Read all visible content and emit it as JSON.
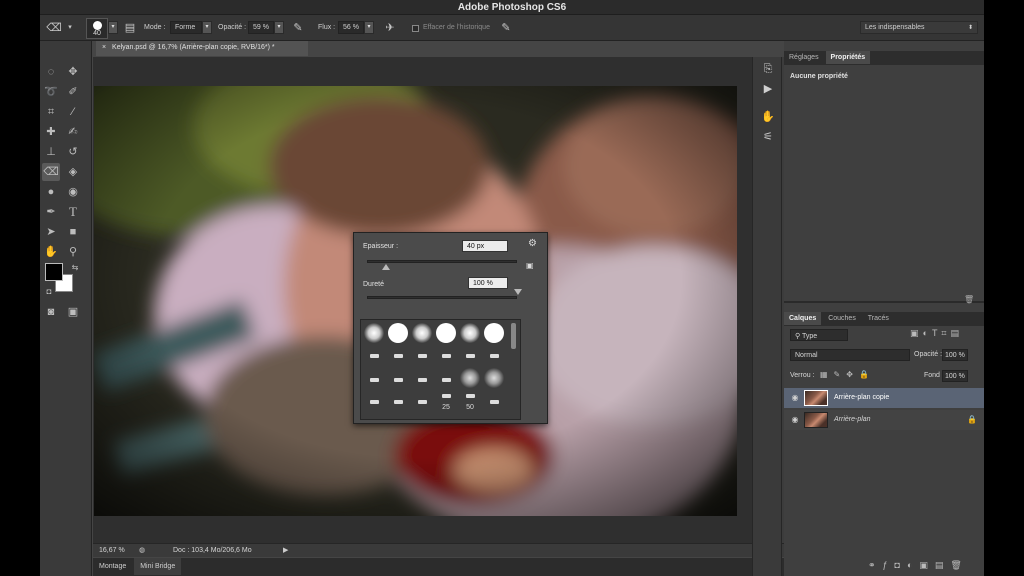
{
  "titlebar": {
    "title": "Adobe Photoshop CS6"
  },
  "options": {
    "brush_size": "40",
    "mode_label": "Mode :",
    "mode_value": "Forme",
    "opacity_label": "Opacité :",
    "opacity_value": "59 %",
    "flow_label": "Flux :",
    "flow_value": "56 %",
    "history_label": "Effacer de l'historique",
    "workspace": "Les indispensables"
  },
  "document": {
    "tab_title": "Kelyan.psd @ 16,7% (Arrière-plan copie, RVB/16*) *",
    "zoom": "16,67 %",
    "doc_info": "Doc : 103,4 Mo/206,6 Mo"
  },
  "bottom_tabs": [
    "Montage",
    "Mini Bridge"
  ],
  "brush_popup": {
    "size_label": "Epaisseur :",
    "size_value": "40 px",
    "hardness_label": "Dureté",
    "hardness_value": "100 %",
    "preset_numbers": [
      "25",
      "50"
    ],
    "size_level": 0.12,
    "hardness_level": 1.0
  },
  "panels": {
    "top_tabs": [
      "Réglages",
      "Propriétés"
    ],
    "properties_text": "Aucune propriété",
    "layers_tabs": [
      "Calques",
      "Couches",
      "Tracés"
    ],
    "filter_value": "Type",
    "blend_mode": "Normal",
    "opacity_label": "Opacité :",
    "opacity_value": "100 %",
    "lock_label": "Verrou :",
    "fill_label": "Fond :",
    "fill_value": "100 %",
    "layers": [
      {
        "name": "Arrière-plan copie",
        "selected": true
      },
      {
        "name": "Arrière-plan",
        "selected": false
      }
    ]
  },
  "colors": {
    "selected_layer": "#5a6475",
    "panel_bg": "#3f3f3f",
    "app_bg": "#454545"
  }
}
